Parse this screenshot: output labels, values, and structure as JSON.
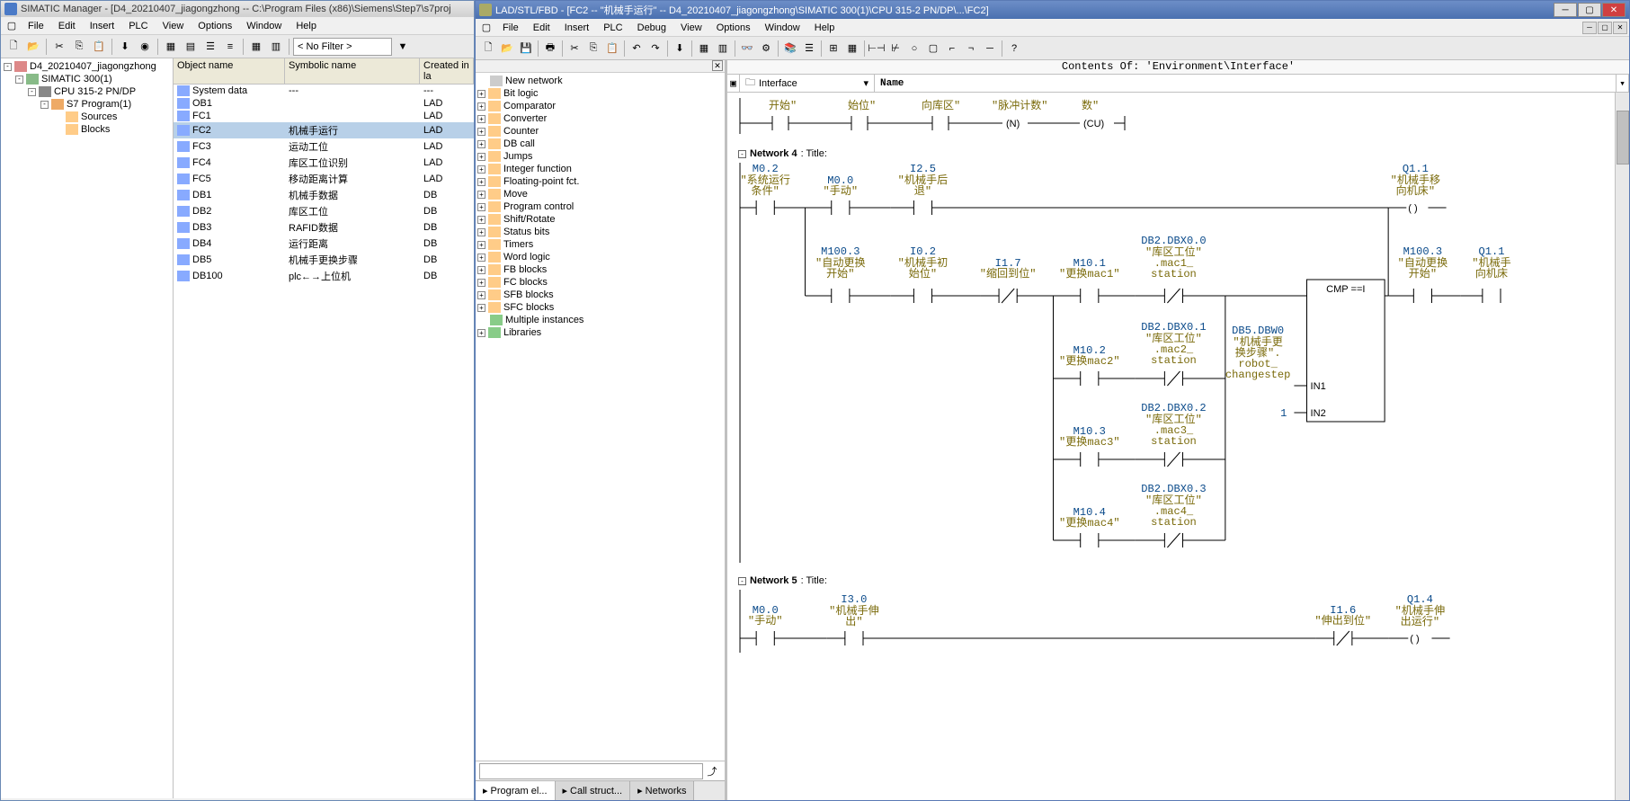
{
  "left_window": {
    "title": "SIMATIC Manager - [D4_20210407_jiagongzhong -- C:\\Program Files (x86)\\Siemens\\Step7\\s7proj",
    "menus": [
      "File",
      "Edit",
      "Insert",
      "PLC",
      "View",
      "Options",
      "Window",
      "Help"
    ],
    "filter": "< No Filter >",
    "tree": [
      {
        "indent": 0,
        "exp": "-",
        "icon": "project",
        "label": "D4_20210407_jiagongzhong"
      },
      {
        "indent": 1,
        "exp": "-",
        "icon": "station",
        "label": "SIMATIC 300(1)"
      },
      {
        "indent": 2,
        "exp": "-",
        "icon": "cpu",
        "label": "CPU 315-2 PN/DP"
      },
      {
        "indent": 3,
        "exp": "-",
        "icon": "program",
        "label": "S7 Program(1)"
      },
      {
        "indent": 4,
        "exp": "",
        "icon": "folder",
        "label": "Sources"
      },
      {
        "indent": 4,
        "exp": "",
        "icon": "folder",
        "label": "Blocks"
      }
    ],
    "columns": {
      "obj": "Object name",
      "sym": "Symbolic name",
      "lang": "Created in la"
    },
    "blocks": [
      {
        "name": "System data",
        "sym": "---",
        "lang": "---"
      },
      {
        "name": "OB1",
        "sym": "",
        "lang": "LAD"
      },
      {
        "name": "FC1",
        "sym": "",
        "lang": "LAD"
      },
      {
        "name": "FC2",
        "sym": "机械手运行",
        "lang": "LAD",
        "selected": true
      },
      {
        "name": "FC3",
        "sym": "运动工位",
        "lang": "LAD"
      },
      {
        "name": "FC4",
        "sym": "库区工位识别",
        "lang": "LAD"
      },
      {
        "name": "FC5",
        "sym": "移动距离计算",
        "lang": "LAD"
      },
      {
        "name": "DB1",
        "sym": "机械手数据",
        "lang": "DB"
      },
      {
        "name": "DB2",
        "sym": "库区工位",
        "lang": "DB"
      },
      {
        "name": "DB3",
        "sym": "RAFID数据",
        "lang": "DB"
      },
      {
        "name": "DB4",
        "sym": "运行距离",
        "lang": "DB"
      },
      {
        "name": "DB5",
        "sym": "机械手更换步骤",
        "lang": "DB"
      },
      {
        "name": "DB100",
        "sym": "plc←→上位机",
        "lang": "DB"
      }
    ]
  },
  "right_window": {
    "title": "LAD/STL/FBD - [FC2 -- \"机械手运行\" -- D4_20210407_jiagongzhong\\SIMATIC 300(1)\\CPU 315-2 PN/DP\\...\\FC2]",
    "menus": [
      "File",
      "Edit",
      "Insert",
      "PLC",
      "Debug",
      "View",
      "Options",
      "Window",
      "Help"
    ],
    "contents": "Contents Of: 'Environment\\Interface'",
    "interface_label": "Interface",
    "name_label": "Name",
    "elements": [
      {
        "exp": "",
        "label": "New network",
        "icon": "net"
      },
      {
        "exp": "+",
        "label": "Bit logic"
      },
      {
        "exp": "+",
        "label": "Comparator"
      },
      {
        "exp": "+",
        "label": "Converter"
      },
      {
        "exp": "+",
        "label": "Counter"
      },
      {
        "exp": "+",
        "label": "DB call"
      },
      {
        "exp": "+",
        "label": "Jumps"
      },
      {
        "exp": "+",
        "label": "Integer function"
      },
      {
        "exp": "+",
        "label": "Floating-point fct."
      },
      {
        "exp": "+",
        "label": "Move"
      },
      {
        "exp": "+",
        "label": "Program control"
      },
      {
        "exp": "+",
        "label": "Shift/Rotate"
      },
      {
        "exp": "+",
        "label": "Status bits"
      },
      {
        "exp": "+",
        "label": "Timers"
      },
      {
        "exp": "+",
        "label": "Word logic"
      },
      {
        "exp": "+",
        "label": "FB blocks"
      },
      {
        "exp": "+",
        "label": "FC blocks"
      },
      {
        "exp": "+",
        "label": "SFB blocks"
      },
      {
        "exp": "+",
        "label": "SFC blocks"
      },
      {
        "exp": "",
        "label": "Multiple instances",
        "icon": "lib"
      },
      {
        "exp": "+",
        "label": "Libraries",
        "icon": "lib"
      }
    ],
    "tabs": [
      {
        "label": "Program el...",
        "active": true
      },
      {
        "label": "Call struct..."
      },
      {
        "label": "Networks"
      }
    ],
    "networks": {
      "n3_labels": {
        "a": "开始\"",
        "b": "始位\"",
        "c": "向库区\"",
        "d": "\"脉冲计数\"",
        "e": "数\""
      },
      "n4_title": "Network 4",
      "n4_suffix": " : Title: ",
      "n5_title": "Network 5",
      "n5_suffix": " : Title: ",
      "cmp_label": "CMP ==I",
      "in1": "IN1",
      "in2": "IN2",
      "one": "1",
      "contacts": {
        "m02": {
          "addr": "M0.2",
          "t1": "\"系统运行",
          "t2": "条件\""
        },
        "m00": {
          "addr": "M0.0",
          "t1": "\"手动\""
        },
        "i25": {
          "addr": "I2.5",
          "t1": "\"机械手后",
          "t2": "退\""
        },
        "q11": {
          "addr": "Q1.1",
          "t1": "\"机械手移",
          "t2": "向机床\""
        },
        "m1003a": {
          "addr": "M100.3",
          "t1": "\"自动更换",
          "t2": "开始\""
        },
        "i02": {
          "addr": "I0.2",
          "t1": "\"机械手初",
          "t2": "始位\""
        },
        "i17": {
          "addr": "I1.7",
          "t1": "\"缩回到位\""
        },
        "m101": {
          "addr": "M10.1",
          "t1": "\"更换mac1\""
        },
        "db20": {
          "addr": "DB2.DBX0.0",
          "t1": "\"库区工位\"",
          "t2": ".mac1_",
          "t3": "station"
        },
        "m102": {
          "addr": "M10.2",
          "t1": "\"更换mac2\""
        },
        "db21": {
          "addr": "DB2.DBX0.1",
          "t1": "\"库区工位\"",
          "t2": ".mac2_",
          "t3": "station"
        },
        "m103": {
          "addr": "M10.3",
          "t1": "\"更换mac3\""
        },
        "db22": {
          "addr": "DB2.DBX0.2",
          "t1": "\"库区工位\"",
          "t2": ".mac3_",
          "t3": "station"
        },
        "m104": {
          "addr": "M10.4",
          "t1": "\"更换mac4\""
        },
        "db23": {
          "addr": "DB2.DBX0.3",
          "t1": "\"库区工位\"",
          "t2": ".mac4_",
          "t3": "station"
        },
        "db5": {
          "addr": "DB5.DBW0",
          "t1": "\"机械手更",
          "t2": "换步骤\".",
          "t3": "robot_",
          "t4": "changestep"
        },
        "m1003b": {
          "addr": "M100.3",
          "t1": "\"自动更换",
          "t2": "开始\""
        },
        "q11b": {
          "addr": "Q1.1",
          "t1": "\"机械手",
          "t2": "向机床"
        },
        "m00b": {
          "addr": "M0.0",
          "t1": "\"手动\""
        },
        "i30": {
          "addr": "I3.0",
          "t1": "\"机械手伸",
          "t2": "出\""
        },
        "i16": {
          "addr": "I1.6",
          "t1": "\"伸出到位\""
        },
        "q14": {
          "addr": "Q1.4",
          "t1": "\"机械手伸",
          "t2": "出运行\""
        }
      }
    }
  }
}
